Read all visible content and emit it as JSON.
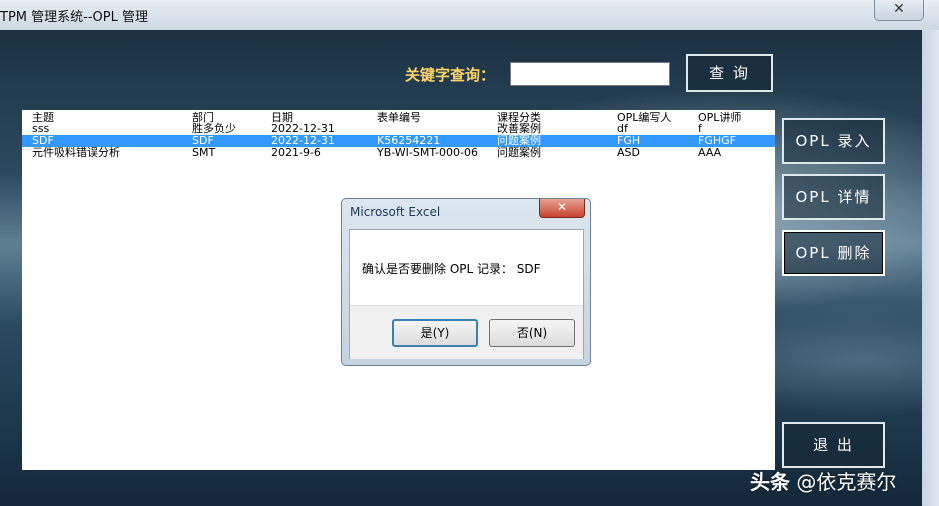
{
  "window": {
    "title": "TPM 管理系统--OPL 管理",
    "close_glyph": "✕"
  },
  "search": {
    "label": "关键字查询：",
    "value": "",
    "button": "查 询"
  },
  "side_buttons": {
    "add": "OPL 录入",
    "details": "OPL 详情",
    "delete": "OPL 删除",
    "exit": "退 出"
  },
  "list": {
    "headers": [
      "主题",
      "部门",
      "日期",
      "表单编号",
      "课程分类",
      "OPL编写人",
      "OPL讲师"
    ],
    "rows": [
      [
        "sss",
        "胜多负少",
        "2022-12-31",
        "",
        "改善案例",
        "df",
        "f"
      ],
      [
        "SDF",
        "SDF",
        "2022-12-31",
        "K56254221",
        "问题案例",
        "FGH",
        "FGHGF"
      ],
      [
        "元件吸料错误分析",
        "SMT",
        "2021-9-6",
        "YB-WI-SMT-000-06",
        "问题案例",
        "ASD",
        "AAA"
      ]
    ],
    "selected_index": 1
  },
  "dialog": {
    "title": "Microsoft Excel",
    "close_glyph": "✕",
    "message": "确认是否要删除 OPL 记录： SDF",
    "yes": "是(Y)",
    "no": "否(N)"
  },
  "watermark": {
    "brand": "头条",
    "handle": "@依克赛尔"
  },
  "colors": {
    "selection": "#3399ff",
    "search_label": "#ffd26a"
  }
}
